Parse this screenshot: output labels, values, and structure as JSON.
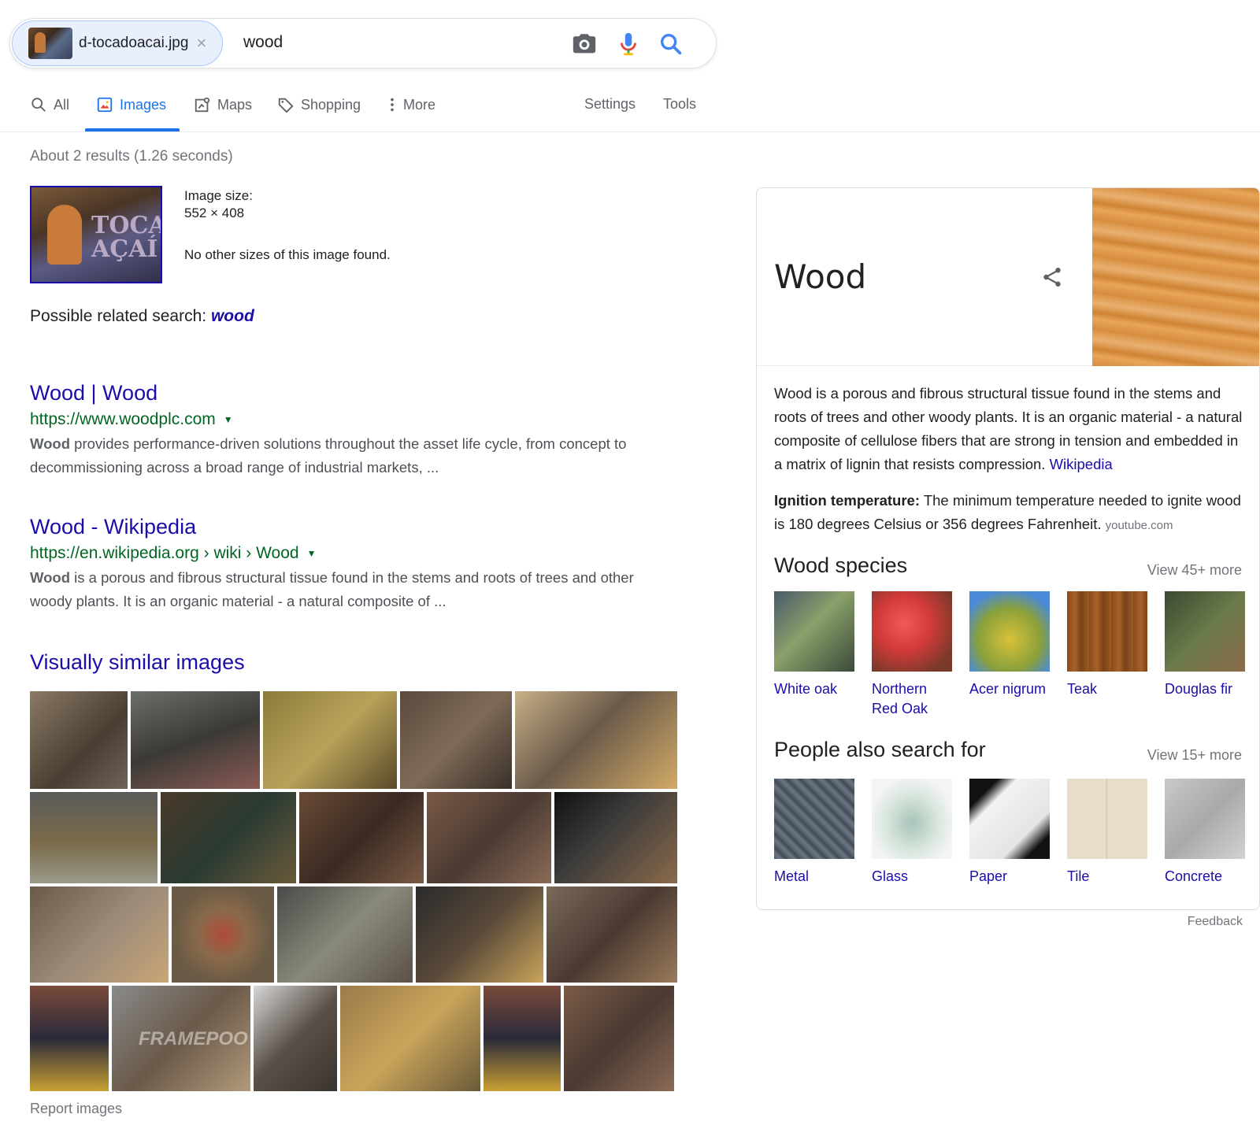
{
  "search": {
    "chip_filename": "d-tocadoacai.jpg",
    "chip_close": "×",
    "query": "wood",
    "icons": [
      "camera-icon",
      "microphone-icon",
      "search-icon"
    ]
  },
  "tabs": {
    "all": "All",
    "images": "Images",
    "maps": "Maps",
    "shopping": "Shopping",
    "more": "More",
    "settings": "Settings",
    "tools": "Tools"
  },
  "results_count": "About 2 results (1.26 seconds)",
  "image_info": {
    "thumb_text": "TOCA AÇAÍ",
    "size_label": "Image size:",
    "size_value": "552 × 408",
    "no_other_sizes": "No other sizes of this image found."
  },
  "related": {
    "label": "Possible related search:",
    "term": "wood"
  },
  "results": [
    {
      "title": "Wood | Wood",
      "url": "https://www.woodplc.com",
      "snippet_bold": "Wood",
      "snippet": " provides performance-driven solutions throughout the asset life cycle, from concept to decommissioning across a broad range of industrial markets, ..."
    },
    {
      "title": "Wood - Wikipedia",
      "url": "https://en.wikipedia.org › wiki › Wood",
      "snippet_bold": "Wood",
      "snippet": " is a porous and fibrous structural tissue found in the stems and roots of trees and other woody plants. It is an organic material - a natural composite of ..."
    }
  ],
  "visually_similar": {
    "title": "Visually similar images",
    "report": "Report images",
    "image_watermark": "FRAMEPOO"
  },
  "knowledge_panel": {
    "title": "Wood",
    "description": "Wood is a porous and fibrous structural tissue found in the stems and roots of trees and other woody plants. It is an organic material - a natural composite of cellulose fibers that are strong in tension and embedded in a matrix of lignin that resists compression.",
    "description_source": "Wikipedia",
    "ignition_label": "Ignition temperature:",
    "ignition_text": " The minimum temperature needed to ignite wood is 180 degrees Celsius or 356 degrees Fahrenheit.",
    "ignition_source": "youtube.com",
    "species": {
      "title": "Wood species",
      "more": "View 45+ more",
      "items": [
        {
          "label": "White oak",
          "color": "#5a6b4a"
        },
        {
          "label": "Northern Red Oak",
          "color": "#d23a3a"
        },
        {
          "label": "Acer nigrum",
          "color": "#c7b43a"
        },
        {
          "label": "Teak",
          "color": "#9a5a22"
        },
        {
          "label": "Douglas fir",
          "color": "#4a5a3a"
        }
      ]
    },
    "people_also": {
      "title": "People also search for",
      "more": "View 15+ more",
      "items": [
        {
          "label": "Metal",
          "color": "#55626e"
        },
        {
          "label": "Glass",
          "color": "#c9d8d0"
        },
        {
          "label": "Paper",
          "color": "#f2f2f2"
        },
        {
          "label": "Tile",
          "color": "#e9dccb"
        },
        {
          "label": "Concrete",
          "color": "#bdbdbb"
        }
      ]
    },
    "feedback": "Feedback"
  },
  "colors": {
    "link": "#1a0dab",
    "url_green": "#006621",
    "accent_blue": "#1a73e8",
    "muted": "#70757a"
  }
}
